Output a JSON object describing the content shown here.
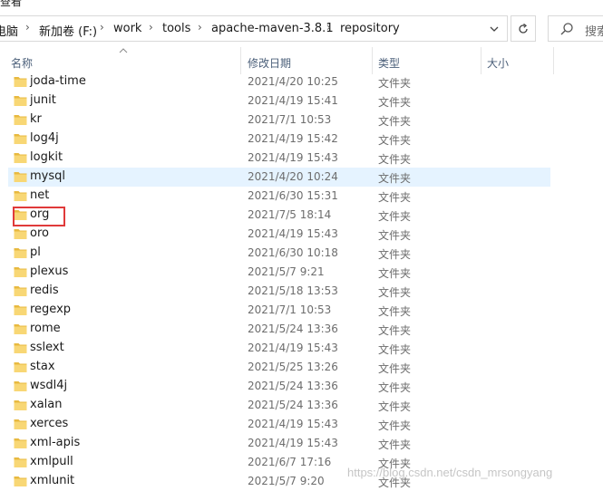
{
  "window": {
    "menu_fragment": "查看"
  },
  "address_bar": {
    "crumbs": [
      "电脑",
      "新加卷 (F:)",
      "work",
      "tools",
      "apache-maven-3.8.1",
      "repository"
    ]
  },
  "search": {
    "placeholder": "搜索"
  },
  "columns": {
    "name": "名称",
    "date": "修改日期",
    "type": "类型",
    "size": "大小"
  },
  "files": [
    {
      "name": "joda-time",
      "date": "2021/4/20 10:25",
      "type": "文件夹"
    },
    {
      "name": "junit",
      "date": "2021/4/19 15:41",
      "type": "文件夹"
    },
    {
      "name": "kr",
      "date": "2021/7/1 10:53",
      "type": "文件夹"
    },
    {
      "name": "log4j",
      "date": "2021/4/19 15:42",
      "type": "文件夹"
    },
    {
      "name": "logkit",
      "date": "2021/4/19 15:43",
      "type": "文件夹"
    },
    {
      "name": "mysql",
      "date": "2021/4/20 10:24",
      "type": "文件夹",
      "selected": true
    },
    {
      "name": "net",
      "date": "2021/6/30 15:31",
      "type": "文件夹"
    },
    {
      "name": "org",
      "date": "2021/7/5 18:14",
      "type": "文件夹",
      "annotated": true
    },
    {
      "name": "oro",
      "date": "2021/4/19 15:43",
      "type": "文件夹"
    },
    {
      "name": "pl",
      "date": "2021/6/30 10:18",
      "type": "文件夹"
    },
    {
      "name": "plexus",
      "date": "2021/5/7 9:21",
      "type": "文件夹"
    },
    {
      "name": "redis",
      "date": "2021/5/18 13:53",
      "type": "文件夹"
    },
    {
      "name": "regexp",
      "date": "2021/7/1 10:53",
      "type": "文件夹"
    },
    {
      "name": "rome",
      "date": "2021/5/24 13:36",
      "type": "文件夹"
    },
    {
      "name": "sslext",
      "date": "2021/4/19 15:43",
      "type": "文件夹"
    },
    {
      "name": "stax",
      "date": "2021/5/25 13:26",
      "type": "文件夹"
    },
    {
      "name": "wsdl4j",
      "date": "2021/5/24 13:36",
      "type": "文件夹"
    },
    {
      "name": "xalan",
      "date": "2021/5/24 13:36",
      "type": "文件夹"
    },
    {
      "name": "xerces",
      "date": "2021/4/19 15:43",
      "type": "文件夹"
    },
    {
      "name": "xml-apis",
      "date": "2021/4/19 15:43",
      "type": "文件夹"
    },
    {
      "name": "xmlpull",
      "date": "2021/6/7 17:16",
      "type": "文件夹"
    },
    {
      "name": "xmlunit",
      "date": "2021/5/7 9:20",
      "type": "文件夹"
    }
  ],
  "colors": {
    "folder": "#f8d775",
    "folder_dark": "#e8b93f",
    "selected_row": "#e5f3ff",
    "annotation": "#e03a3a"
  },
  "icons": {
    "folder": "folder-icon",
    "refresh": "refresh-icon",
    "search": "search-icon",
    "dropdown": "chevron-down-icon"
  },
  "watermark": "https://blog.csdn.net/csdn_mrsongyang"
}
